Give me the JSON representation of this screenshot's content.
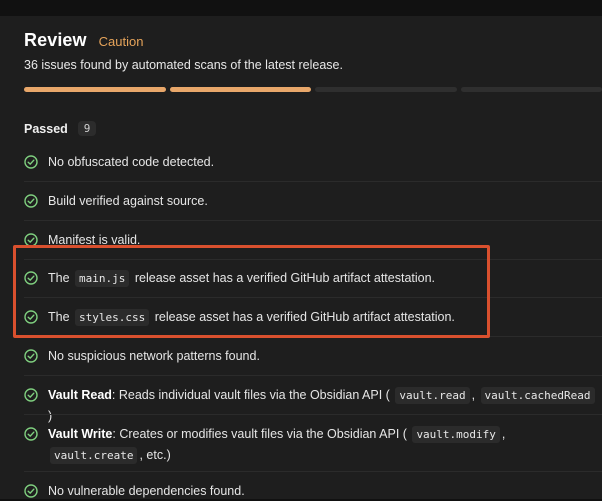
{
  "header": {
    "title": "Review",
    "status": "Caution",
    "summary": "36 issues found by automated scans of the latest release."
  },
  "progress": {
    "filled_segments": 2,
    "total_segments": 4
  },
  "passed": {
    "label": "Passed",
    "count": "9"
  },
  "items": {
    "i0": {
      "text": "No obfuscated code detected."
    },
    "i1": {
      "text": "Build verified against source."
    },
    "i2": {
      "text": "Manifest is valid."
    },
    "i3": {
      "pre": "The",
      "code": "main.js",
      "post": "release asset has a verified GitHub artifact attestation."
    },
    "i4": {
      "pre": "The",
      "code": "styles.css",
      "post": "release asset has a verified GitHub artifact attestation."
    },
    "i5": {
      "text": "No suspicious network patterns found."
    },
    "i6": {
      "title": "Vault Read",
      "desc": ": Reads individual vault files via the Obsidian API (",
      "code1": "vault.read",
      "sep": ",",
      "code2": "vault.cachedRead",
      "end": ")"
    },
    "i7": {
      "title": "Vault Write",
      "desc": ": Creates or modifies vault files via the Obsidian API (",
      "code1": "vault.modify",
      "sep": ",",
      "code2": "vault.create",
      "end": ", etc.)"
    },
    "i8": {
      "text": "No vulnerable dependencies found."
    }
  },
  "colors": {
    "accent": "#e8a76a",
    "caution": "#e5a35a",
    "check": "#7fcf7f",
    "highlight": "#d9502e"
  },
  "icons": {
    "check": "check-circle-icon"
  }
}
